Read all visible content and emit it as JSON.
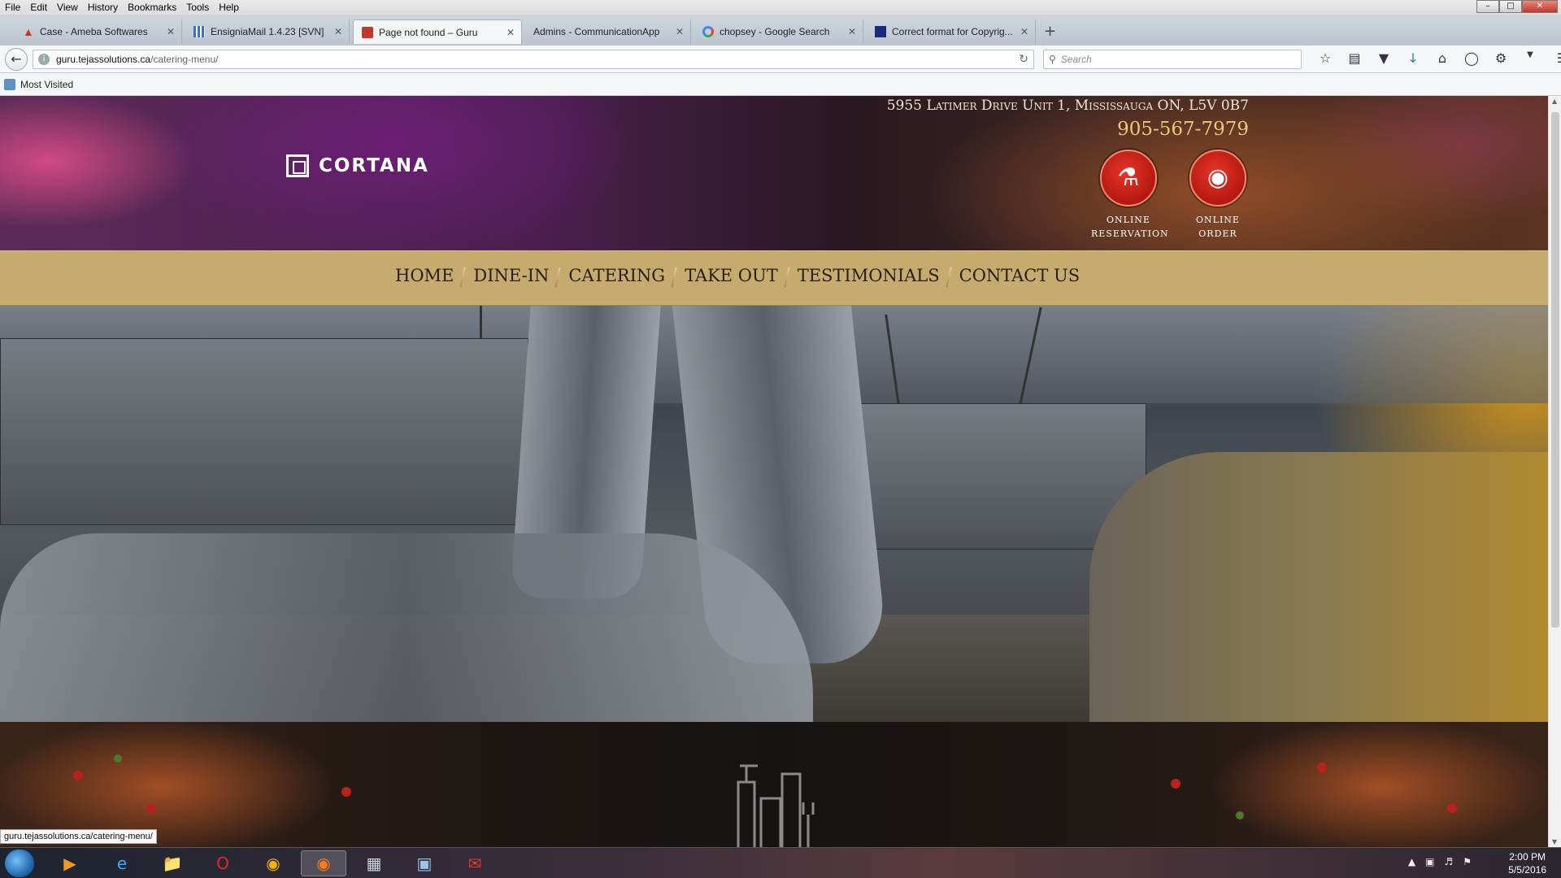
{
  "browser": {
    "menu": [
      "File",
      "Edit",
      "View",
      "History",
      "Bookmarks",
      "Tools",
      "Help"
    ],
    "tabs": [
      {
        "title": "Case - Ameba Softwares",
        "icon": "ameba-icon",
        "color": "#c0392b"
      },
      {
        "title": "EnsigniaMail 1.4.23 [SVN]",
        "icon": "grid-icon",
        "color": "#3d6fd0"
      },
      {
        "title": "Page not found – Guru",
        "icon": "guru-icon",
        "color": "#c0392b"
      },
      {
        "title": "Admins - CommunicationApp",
        "icon": "none",
        "color": "#ffffff"
      },
      {
        "title": "chopsey - Google Search",
        "icon": "google-icon",
        "color": "#4285f4"
      },
      {
        "title": "Correct format for Copyrig...",
        "icon": "stack-icon",
        "color": "#1a2a7a"
      }
    ],
    "active_tab_index": 2,
    "url_host": "guru.tejassolutions.ca",
    "url_path": "/catering-menu/",
    "search_placeholder": "Search",
    "bookmarks": {
      "most_visited": "Most Visited"
    },
    "status_link": "guru.tejassolutions.ca/catering-menu/"
  },
  "site": {
    "logo_text": "CORTANA",
    "address": "5955 Latimer Drive Unit 1, Mississauga ON, L5V 0B7",
    "phone": "905-567-7979",
    "badges": [
      {
        "line1": "ONLINE",
        "line2": "RESERVATION",
        "icon": "dining-table-icon"
      },
      {
        "line1": "ONLINE",
        "line2": "ORDER",
        "icon": "plate-cutlery-icon"
      }
    ],
    "nav": [
      "HOME",
      "DINE-IN",
      "CATERING",
      "TAKE OUT",
      "TESTIMONIALS",
      "CONTACT US"
    ],
    "colors": {
      "nav_bg": "#c5ab6d",
      "phone": "#e9c97a",
      "badge": "#d22a1f"
    }
  },
  "taskbar": {
    "time": "2:00 PM",
    "date": "5/5/2016"
  }
}
